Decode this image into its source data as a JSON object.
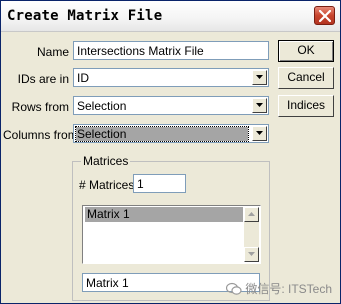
{
  "window": {
    "title": "Create Matrix File"
  },
  "form": {
    "name_label": "Name",
    "name_value": "Intersections Matrix File",
    "ids_label": "IDs are in",
    "ids_value": "ID",
    "rows_label": "Rows from",
    "rows_value": "Selection",
    "columns_label": "Columns from",
    "columns_value": "Selection"
  },
  "buttons": {
    "ok": "OK",
    "cancel": "Cancel",
    "indices": "Indices"
  },
  "matrices": {
    "group_label": "Matrices",
    "count_label": "# Matrices",
    "count_value": "1",
    "list_items": [
      "Matrix 1"
    ],
    "selected_index": 0,
    "edit_value": "Matrix 1"
  },
  "watermark": {
    "text": "微信号: ITSTech"
  },
  "icons": {
    "close": "close-icon",
    "dropdown": "chevron-down-icon",
    "scroll_up": "scroll-up-icon",
    "scroll_down": "scroll-down-icon",
    "watermark": "wechat-icon"
  },
  "colors": {
    "dialog_bg": "#ece9d8",
    "close_button": "#c8452d",
    "selection": "#a5a5a5"
  }
}
